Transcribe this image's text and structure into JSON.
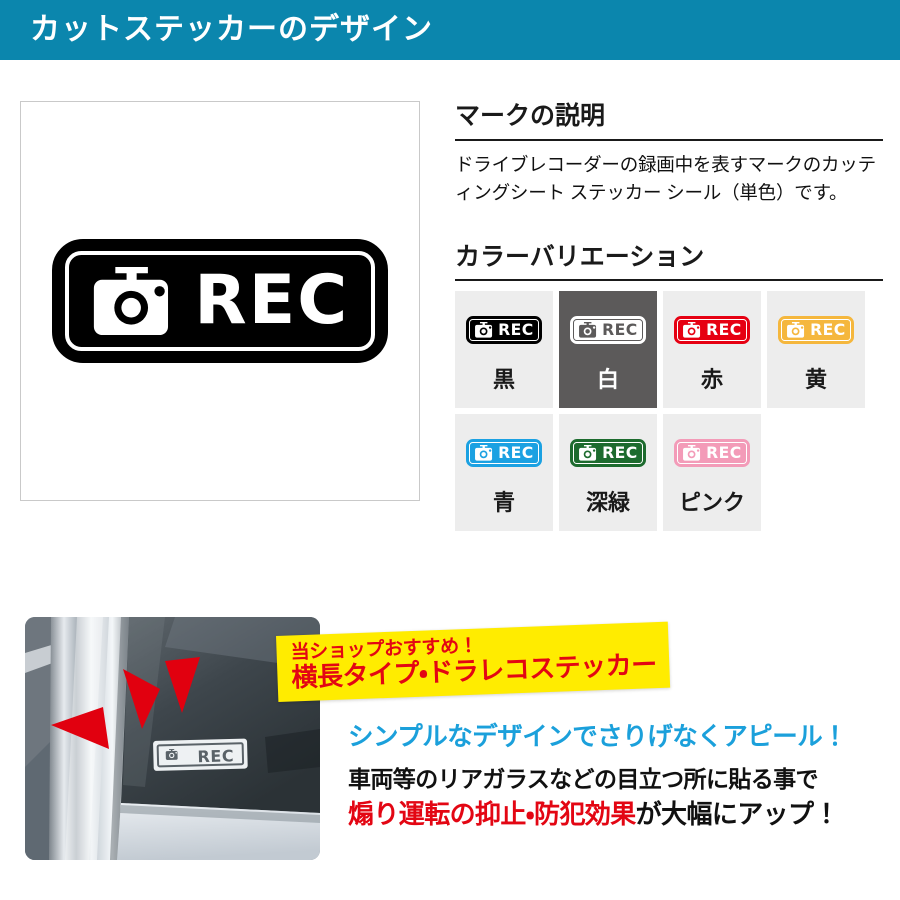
{
  "header": {
    "title": "カットステッカーのデザイン",
    "bg_color": "#0b86ad",
    "text_color": "#ffffff"
  },
  "hero": {
    "badge_text": "REC",
    "icon": "camera-icon",
    "fill_color": "#000000",
    "inner_border_color": "#ffffff"
  },
  "mark_section": {
    "heading": "マークの説明",
    "body": "ドライブレコーダーの録画中を表すマークのカッティングシート ステッカー シール（単色）です。"
  },
  "colors_section": {
    "heading": "カラーバリエーション",
    "swatches": [
      {
        "label": "黒",
        "badge_text": "REC",
        "badge_color": "#000000",
        "inner_color": "#ffffff",
        "tile_bg": "#ededed",
        "label_color": "#1a1a1a"
      },
      {
        "label": "白",
        "badge_text": "REC",
        "badge_color": "#ffffff",
        "inner_color": "#5c5a5a",
        "tile_bg": "#5c5a5a",
        "label_color": "#ffffff"
      },
      {
        "label": "赤",
        "badge_text": "REC",
        "badge_color": "#e60012",
        "inner_color": "#ffffff",
        "tile_bg": "#ededed",
        "label_color": "#1a1a1a"
      },
      {
        "label": "黄",
        "badge_text": "REC",
        "badge_color": "#f5b73d",
        "inner_color": "#ffffff",
        "tile_bg": "#ededed",
        "label_color": "#1a1a1a"
      },
      {
        "label": "青",
        "badge_text": "REC",
        "badge_color": "#1ba1e2",
        "inner_color": "#ffffff",
        "tile_bg": "#ededed",
        "label_color": "#1a1a1a"
      },
      {
        "label": "深緑",
        "badge_text": "REC",
        "badge_color": "#1d6b2e",
        "inner_color": "#ffffff",
        "tile_bg": "#ededed",
        "label_color": "#1a1a1a"
      },
      {
        "label": "ピンク",
        "badge_text": "REC",
        "badge_color": "#f39bb8",
        "inner_color": "#ffffff",
        "tile_bg": "#ededed",
        "label_color": "#1a1a1a"
      }
    ]
  },
  "photo": {
    "alt": "車のリアガラスに貼ったRECステッカーの装着例",
    "sticker_text": "REC",
    "arrow_color": "#e1000f",
    "arrow_count": 3
  },
  "banner": {
    "line1": "当ショップおすすめ！",
    "line2": "横長タイプ・ドラレコステッカー",
    "bg_color": "#ffec00",
    "text_color": "#e30613"
  },
  "promo": {
    "line_cyan": "シンプルなデザインでさりげなくアピール！",
    "line_plain": "車両等のリアガラスなどの目立つ所に貼る事で",
    "line_last_red": "煽り運転の抑止・防犯効果",
    "line_last_tail": "が大幅にアップ！",
    "cyan_color": "#1ba0db",
    "red_color": "#e30613"
  }
}
